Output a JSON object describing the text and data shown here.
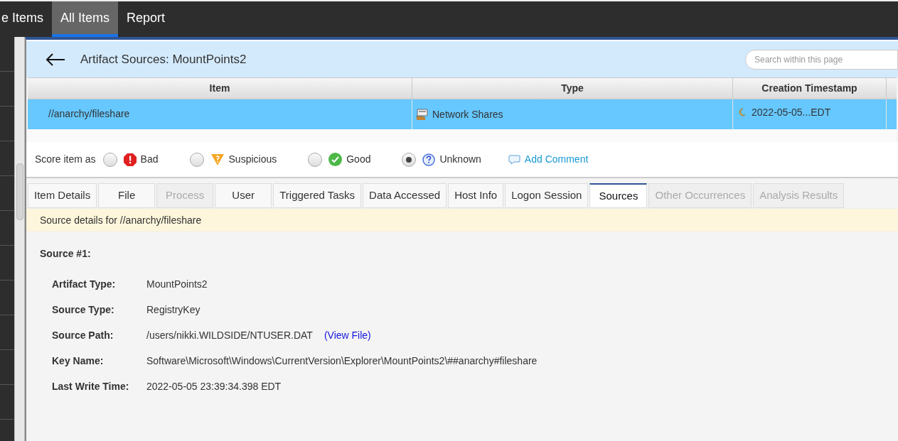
{
  "top_tabs": [
    {
      "label": "e Items",
      "selected": false
    },
    {
      "label": "All Items",
      "selected": true
    },
    {
      "label": "Report",
      "selected": false
    }
  ],
  "header": {
    "title": "Artifact Sources: MountPoints2",
    "search": {
      "placeholder": "Search within this page"
    }
  },
  "table": {
    "columns": [
      "Item",
      "Type",
      "Creation Timestamp"
    ],
    "rows": [
      {
        "selected": true,
        "item": "//anarchy/fileshare",
        "type": "Network Shares",
        "creation_timestamp": "2022-05-05...EDT"
      }
    ]
  },
  "score": {
    "label": "Score item as",
    "options": [
      {
        "kind": "bad",
        "label": "Bad",
        "selected": false
      },
      {
        "kind": "suspicious",
        "label": "Suspicious",
        "selected": false
      },
      {
        "kind": "good",
        "label": "Good",
        "selected": false
      },
      {
        "kind": "unknown",
        "label": "Unknown",
        "selected": true
      }
    ],
    "add_comment": "Add Comment"
  },
  "detail_tabs": [
    {
      "label": "Item Details",
      "selected": false,
      "disabled": false
    },
    {
      "label": "File",
      "selected": false,
      "disabled": false
    },
    {
      "label": "Process",
      "selected": false,
      "disabled": true
    },
    {
      "label": "User",
      "selected": false,
      "disabled": false
    },
    {
      "label": "Triggered Tasks",
      "selected": false,
      "disabled": false
    },
    {
      "label": "Data Accessed",
      "selected": false,
      "disabled": false
    },
    {
      "label": "Host Info",
      "selected": false,
      "disabled": false
    },
    {
      "label": "Logon Session",
      "selected": false,
      "disabled": false
    },
    {
      "label": "Sources",
      "selected": true,
      "disabled": false
    },
    {
      "label": "Other Occurrences",
      "selected": false,
      "disabled": true
    },
    {
      "label": "Analysis Results",
      "selected": false,
      "disabled": true
    }
  ],
  "banner": "Source details for //anarchy/fileshare",
  "source": {
    "heading": "Source #1:",
    "fields": [
      {
        "label": "Artifact Type:",
        "value": "MountPoints2"
      },
      {
        "label": "Source Type:",
        "value": "RegistryKey"
      },
      {
        "label": "Source Path:",
        "value": "/users/nikki.WILDSIDE/NTUSER.DAT",
        "link": "(View File)"
      },
      {
        "label": "Key Name:",
        "value": "Software\\Microsoft\\Windows\\CurrentVersion\\Explorer\\MountPoints2\\##anarchy#fileshare"
      },
      {
        "label": "Last Write Time:",
        "value": "2022-05-05 23:39:34.398 EDT"
      }
    ]
  }
}
